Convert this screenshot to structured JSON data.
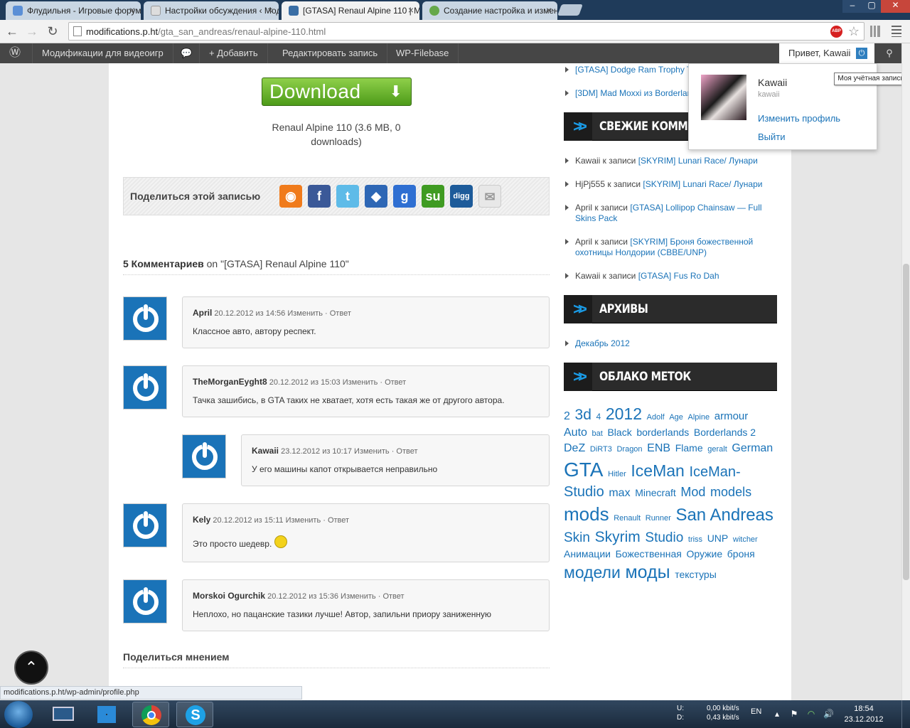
{
  "browser": {
    "tabs": [
      {
        "title": "Флудильня - Игровые форум",
        "icon_color": "#5b8fd6"
      },
      {
        "title": "Настройки обсуждения ‹ Мод",
        "icon_color": "#dddddd"
      },
      {
        "title": "[GTASA] Renaul Alpine 110 | М",
        "icon_color": "#3a6ea5"
      },
      {
        "title": "Создание настройка и измен",
        "icon_color": "#66a84a"
      }
    ],
    "window_buttons": [
      "–",
      "▢",
      "✕"
    ],
    "url_host": "modifications.p.ht",
    "url_path": "/gta_san_andreas/renaul-alpine-110.html",
    "abp_label": "ABP"
  },
  "adminbar": {
    "items": [
      "Модификации для видеоигр",
      "+ Добавить",
      "Редактировать запись",
      "WP-Filebase"
    ],
    "greeting": "Привет, Kawaii"
  },
  "download": {
    "button_label": "Download",
    "file_info": "Renaul Alpine 110 (3.6 MB, 0 downloads)"
  },
  "share": {
    "label": "Поделиться этой записью",
    "icons": [
      {
        "name": "rss-icon",
        "glyph": "◉",
        "color": "#f07b1b"
      },
      {
        "name": "facebook-icon",
        "glyph": "f",
        "color": "#3b5998"
      },
      {
        "name": "twitter-icon",
        "glyph": "t",
        "color": "#5ebbe8"
      },
      {
        "name": "myspace-icon",
        "glyph": "◆",
        "color": "#2e67b5"
      },
      {
        "name": "google-icon",
        "glyph": "g",
        "color": "#2f6fd2"
      },
      {
        "name": "stumbleupon-icon",
        "glyph": "su",
        "color": "#3f9b22"
      },
      {
        "name": "digg-icon",
        "glyph": "digg",
        "color": "#1d5b9a"
      },
      {
        "name": "email-icon",
        "glyph": "✉",
        "color": "#e8e8e8"
      }
    ]
  },
  "comments": {
    "count_label": "5 Комментариев",
    "on_label": "on \"[GTASA] Renaul Alpine 110\"",
    "items": [
      {
        "author": "April",
        "date": "20.12.2012 из 14:56",
        "actions": "Изменить · Ответ",
        "text": "Классное авто, автору респект."
      },
      {
        "author": "TheMorganEyght8",
        "date": "20.12.2012 из 15:03",
        "actions": "Изменить · Ответ",
        "text": "Тачка зашибись, в GTA таких не хватает, хотя есть такая же от другого автора."
      },
      {
        "author": "Kawaii",
        "date": "23.12.2012 из 10:17",
        "actions": "Изменить · Ответ",
        "text": "У его машины капот открывается неправильно"
      },
      {
        "author": "Kely",
        "date": "20.12.2012 из 15:11",
        "actions": "Изменить · Ответ",
        "text": "Это просто шедевр."
      },
      {
        "author": "Morskoi Ogurchik",
        "date": "20.12.2012 из 15:36",
        "actions": "Изменить · Ответ",
        "text": "Неплохо, но пацанские тазики лучше! Автор, запильни приору заниженную"
      }
    ],
    "reply_heading": "Поделиться мнением"
  },
  "sidebar": {
    "top_links": [
      "[GTASA] Dodge Ram Trophy T",
      "[3DM] Mad Moxxi из Borderlan"
    ],
    "recent_comments_title": "СВЕЖИЕ КОММЕНТАРИИ",
    "recent_comments": [
      {
        "who": "Kawaii к записи",
        "link": "[SKYRIM] Lunari Race/ Лунари"
      },
      {
        "who": "HjPj555 к записи",
        "link": "[SKYRIM] Lunari Race/ Лунари"
      },
      {
        "who": "April к записи",
        "link": "[GTASA] Lollipop Chainsaw — Full Skins Pack"
      },
      {
        "who": "April к записи",
        "link": "[SKYRIM] Броня божественной охотницы Нолдории (CBBE/UNP)"
      },
      {
        "who": "Kawaii к записи",
        "link": "[GTASA] Fus Ro Dah"
      }
    ],
    "archives_title": "АРХИВЫ",
    "archives": [
      "Декабрь 2012"
    ],
    "tags_title": "ОБЛАКО МЕТОК",
    "tags": [
      {
        "t": "2",
        "s": 16
      },
      {
        "t": "3d",
        "s": 21
      },
      {
        "t": "4",
        "s": 12
      },
      {
        "t": "2012",
        "s": 23
      },
      {
        "t": "Adolf",
        "s": 11
      },
      {
        "t": "Age",
        "s": 11
      },
      {
        "t": "Alpine",
        "s": 11
      },
      {
        "t": "armour",
        "s": 15
      },
      {
        "t": "Auto",
        "s": 16
      },
      {
        "t": "bat",
        "s": 11
      },
      {
        "t": "Black",
        "s": 14
      },
      {
        "t": "borderlands",
        "s": 14
      },
      {
        "t": "Borderlands 2",
        "s": 14
      },
      {
        "t": "DeZ",
        "s": 16
      },
      {
        "t": "DiRT3",
        "s": 11
      },
      {
        "t": "Dragon",
        "s": 11
      },
      {
        "t": "ENB",
        "s": 16
      },
      {
        "t": "Flame",
        "s": 14
      },
      {
        "t": "geralt",
        "s": 11
      },
      {
        "t": "German",
        "s": 16
      },
      {
        "t": "GTA",
        "s": 28
      },
      {
        "t": "Hitler",
        "s": 11
      },
      {
        "t": "IceMan",
        "s": 23
      },
      {
        "t": "IceMan-Studio",
        "s": 20
      },
      {
        "t": "max",
        "s": 16
      },
      {
        "t": "Minecraft",
        "s": 14
      },
      {
        "t": "Mod",
        "s": 18
      },
      {
        "t": "models",
        "s": 18
      },
      {
        "t": "mods",
        "s": 26
      },
      {
        "t": "Renault",
        "s": 11
      },
      {
        "t": "Runner",
        "s": 11
      },
      {
        "t": "San Andreas",
        "s": 24
      },
      {
        "t": "Skin",
        "s": 19
      },
      {
        "t": "Skyrim",
        "s": 21
      },
      {
        "t": "Studio",
        "s": 19
      },
      {
        "t": "triss",
        "s": 11
      },
      {
        "t": "UNP",
        "s": 14
      },
      {
        "t": "witcher",
        "s": 11
      },
      {
        "t": "Анимации",
        "s": 14
      },
      {
        "t": "Божественная",
        "s": 14
      },
      {
        "t": "Оружие",
        "s": 14
      },
      {
        "t": "броня",
        "s": 14
      },
      {
        "t": "модели",
        "s": 23
      },
      {
        "t": "моды",
        "s": 25
      },
      {
        "t": "текстуры",
        "s": 14
      }
    ]
  },
  "user_menu": {
    "name": "Kawaii",
    "login": "kawaii",
    "edit_profile": "Изменить профиль",
    "logout": "Выйти",
    "tooltip": "Моя учётная запись"
  },
  "status_bar_url": "modifications.p.ht/wp-admin/profile.php",
  "taskbar": {
    "speed_up_label": "U:",
    "speed_down_label": "D:",
    "speed_up": "0,00 kbit/s",
    "speed_down": "0,43 kbit/s",
    "lang": "EN",
    "time": "18:54",
    "date": "23.12.2012"
  }
}
